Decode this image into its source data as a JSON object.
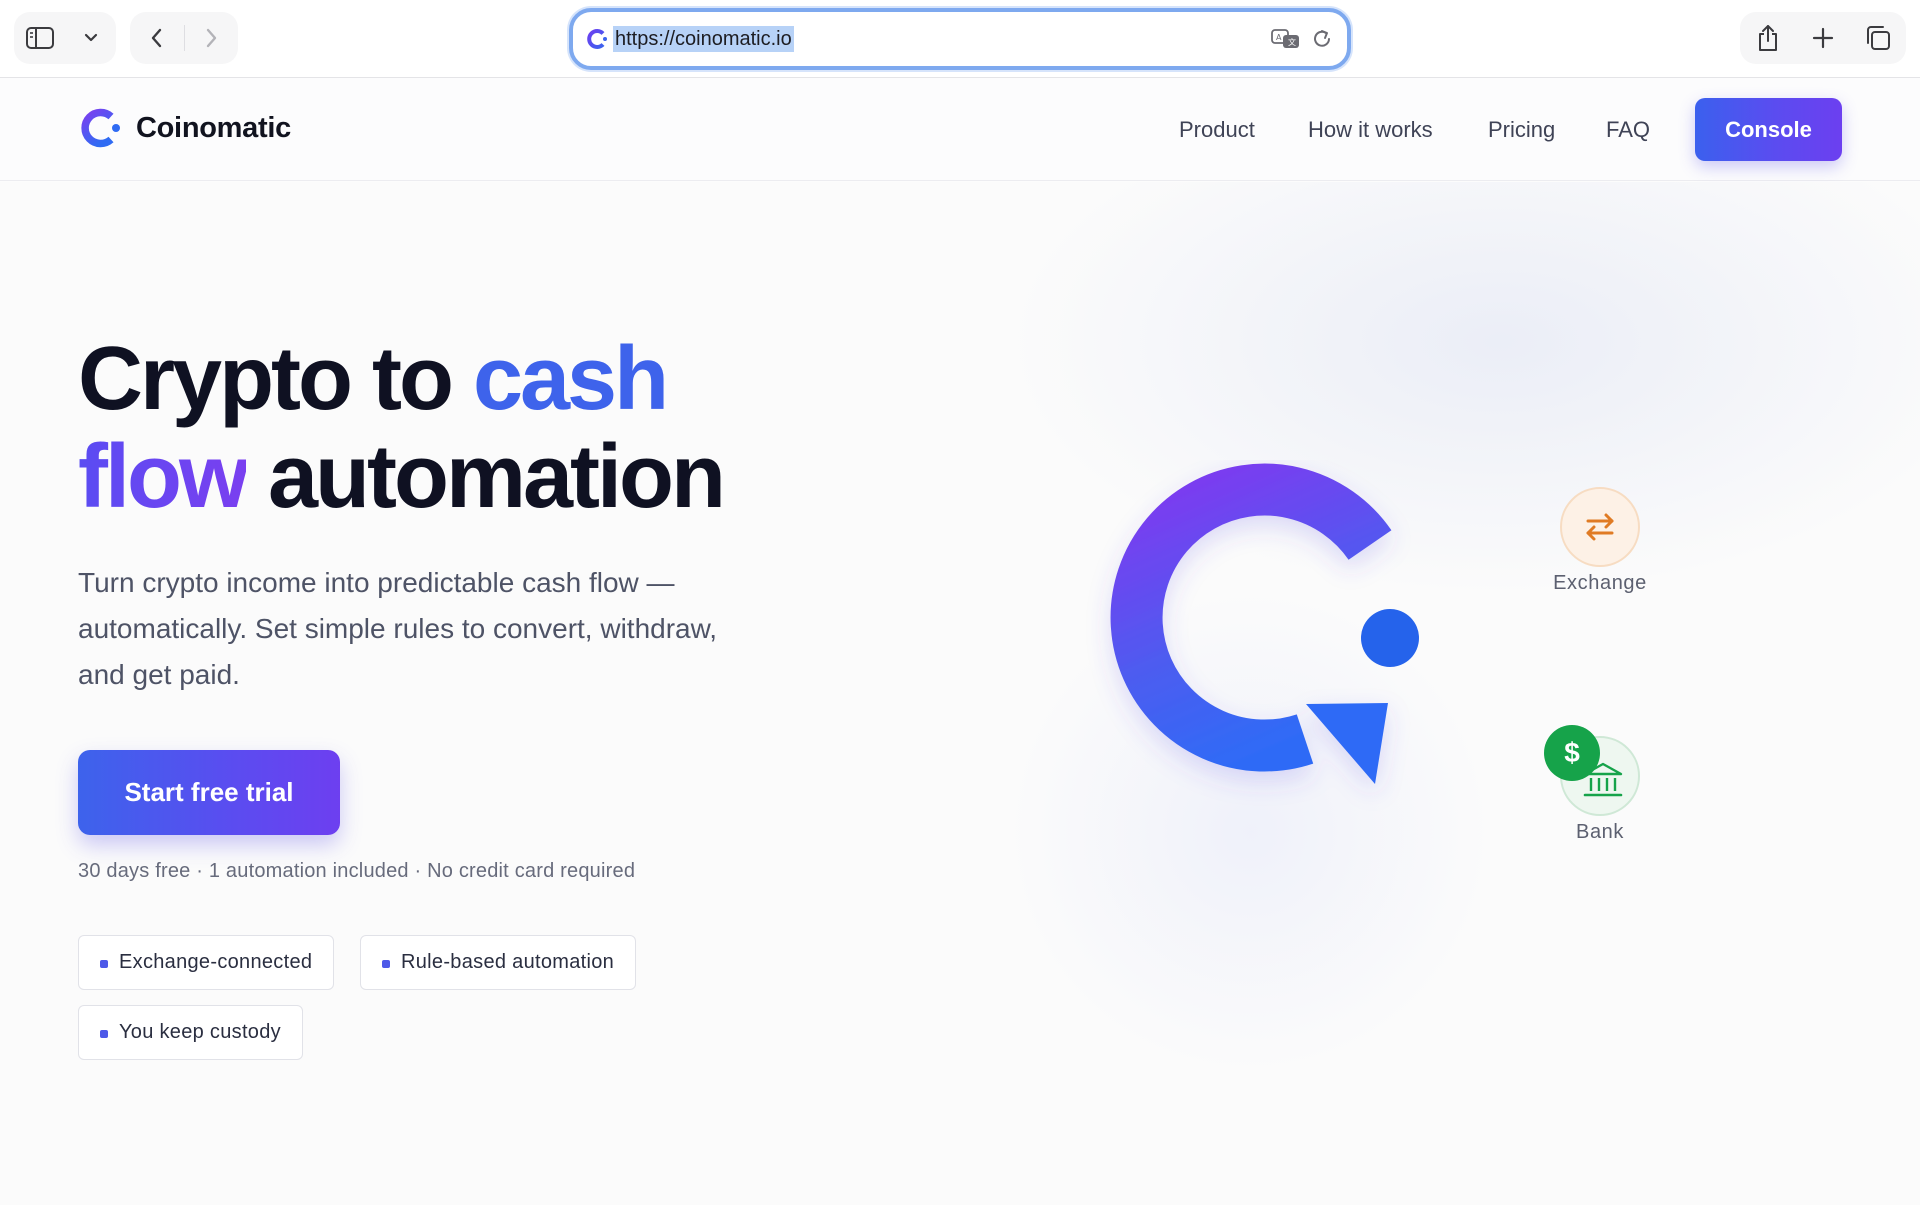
{
  "browser": {
    "url": "https://coinomatic.io",
    "sidebar_icon": "sidebar-icon",
    "tab_menu_icon": "chevron-down-icon",
    "back_icon": "chevron-left-icon",
    "forward_icon": "chevron-right-icon",
    "translate_icon": "translate-icon",
    "reload_icon": "reload-icon",
    "share_icon": "share-icon",
    "new_tab_icon": "plus-icon",
    "tabs_overview_icon": "tabs-icon"
  },
  "header": {
    "brand_name": "Coinomatic",
    "nav": [
      "Product",
      "How it works",
      "Pricing",
      "FAQ"
    ],
    "console_label": "Console"
  },
  "hero": {
    "headline": {
      "part1": "Crypto to ",
      "accent1": "cash",
      "accent2": "flow",
      "part2": " automation"
    },
    "subhead": "Turn crypto income into predictable cash flow — automatically. Set simple rules to convert, withdraw, and get paid.",
    "cta_label": "Start free trial",
    "cta_note": "30 days free · 1 automation included · No credit card required",
    "features": [
      "Exchange-connected",
      "Rule-based automation",
      "You keep custody"
    ]
  },
  "illustration": {
    "exchange_label": "Exchange",
    "bank_label": "Bank",
    "dollar_symbol": "$"
  },
  "colors": {
    "brand_blue": "#3e63eb",
    "brand_purple": "#6c3ff0",
    "exchange_orange": "#e07b24",
    "bank_green": "#16a34a"
  }
}
